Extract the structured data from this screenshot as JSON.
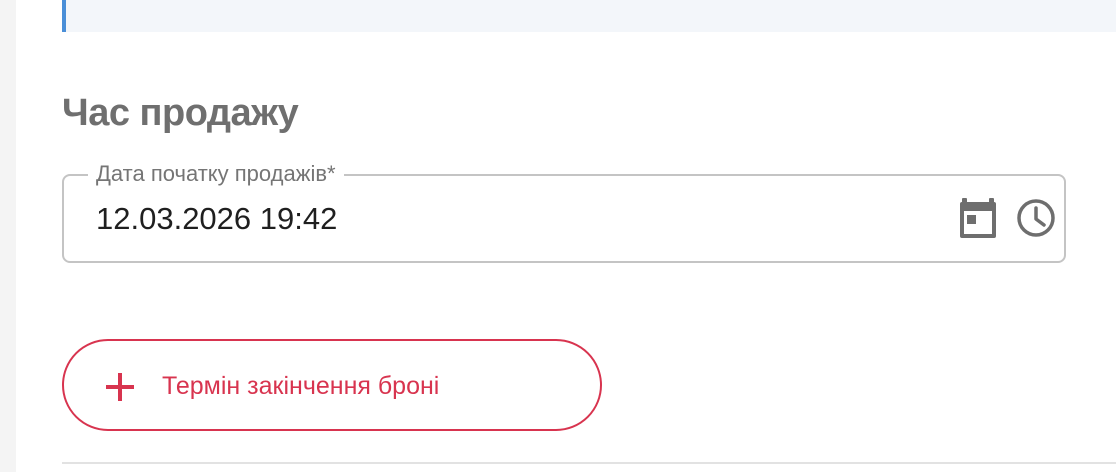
{
  "section": {
    "title": "Час продажу"
  },
  "sale_start": {
    "label": "Дата початку продажів*",
    "value": "12.03.2026 19:42",
    "calendar_icon": "calendar-icon",
    "clock_icon": "clock-icon"
  },
  "reservation": {
    "add_label": "Термін закінчення броні",
    "add_icon": "plus-icon"
  },
  "colors": {
    "accent": "#d8344f",
    "banner_border": "#4a8fd8",
    "banner_bg": "#f3f6fa",
    "field_border": "#c4c4c4",
    "title_text": "#6f6f6f",
    "icon_gray": "#6e6e6e"
  }
}
